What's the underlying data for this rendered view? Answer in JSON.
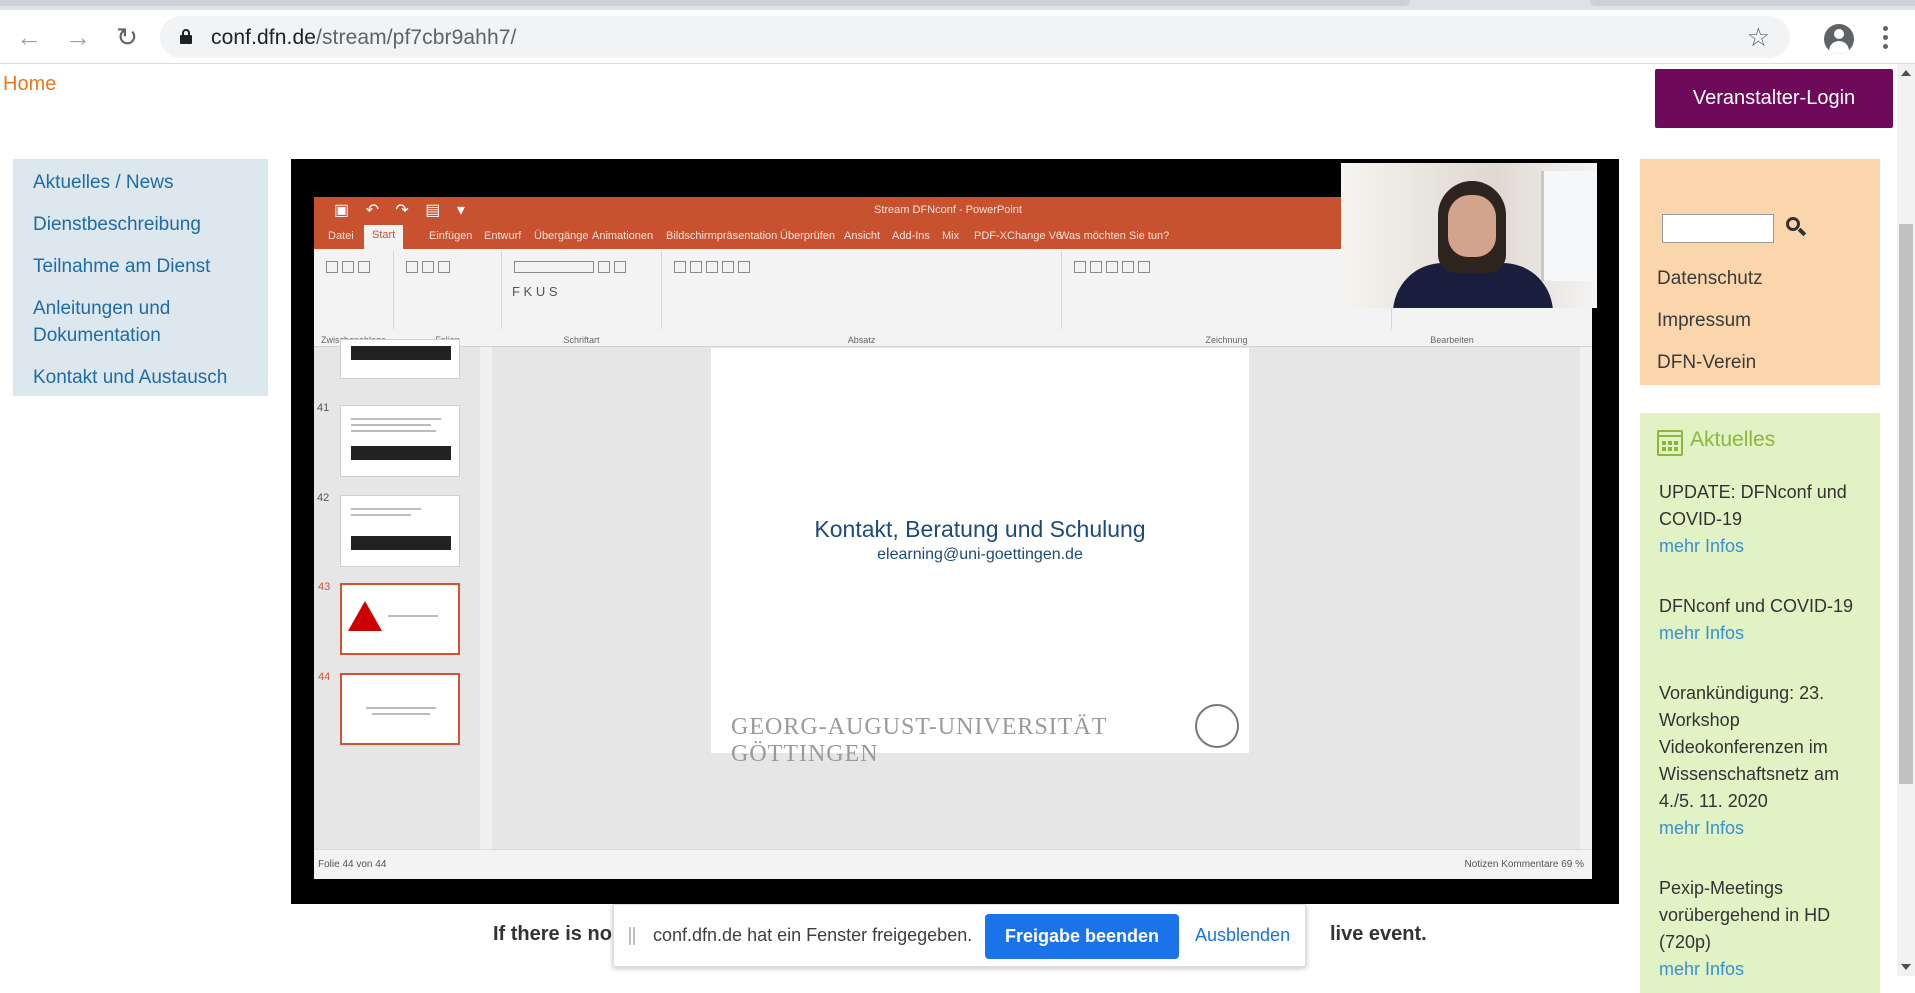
{
  "browser": {
    "url_host": "conf.dfn.de",
    "url_path": "/stream/pf7cbr9ahh7/"
  },
  "header": {
    "home": "Home",
    "login": "Veranstalter-Login"
  },
  "leftnav": {
    "items": [
      "Aktuelles / News",
      "Dienstbeschreibung",
      "Teilnahme am Dienst",
      "Anleitungen und Dokumentation",
      "Kontakt und Austausch"
    ]
  },
  "video": {
    "ppt_title": "Stream DFNconf - PowerPoint",
    "menu": [
      "Datei",
      "Start",
      "Einfügen",
      "Entwurf",
      "Übergänge",
      "Animationen",
      "Bildschirmpräsentation",
      "Überprüfen",
      "Ansicht",
      "Add-Ins",
      "Mix",
      "PDF-XChange V6",
      "Was möchten Sie tun?"
    ],
    "ribbon_groups": [
      "Zwischenablage",
      "Folien",
      "Schriftart",
      "Absatz",
      "Zeichnung",
      "Bearbeiten"
    ],
    "thumbs": [
      "41",
      "42",
      "43",
      "44"
    ],
    "slide_title": "Kontakt, Beratung und Schulung",
    "slide_subtitle": "elearning@uni-goettingen.de",
    "slide_footer": "GEORG-AUGUST-UNIVERSITÄT GÖTTINGEN",
    "status_left": "Folie 44 von 44",
    "status_right": "Notizen   Kommentare          69 %"
  },
  "caption": {
    "left": "If there is no",
    "right": "live event."
  },
  "sharebar": {
    "message": "conf.dfn.de hat ein Fenster freigegeben.",
    "stop": "Freigabe beenden",
    "hide": "Ausblenden"
  },
  "sidebar": {
    "links": [
      "Datenschutz",
      "Impressum",
      "DFN-Verein"
    ],
    "news_title": "Aktuelles",
    "more": "mehr Infos",
    "news": [
      "UPDATE: DFNconf und COVID-19",
      "DFNconf und COVID-19",
      "Vorankündigung: 23. Workshop Videokonferenzen im Wissenschaftsnetz am 4./5. 11. 2020",
      "Pexip-Meetings vorübergehend in HD (720p)"
    ]
  },
  "colors": {
    "accent_login": "#6e0a59",
    "home": "#e8791f",
    "ppt_orange": "#c8512f",
    "share_blue": "#1a73e8"
  }
}
